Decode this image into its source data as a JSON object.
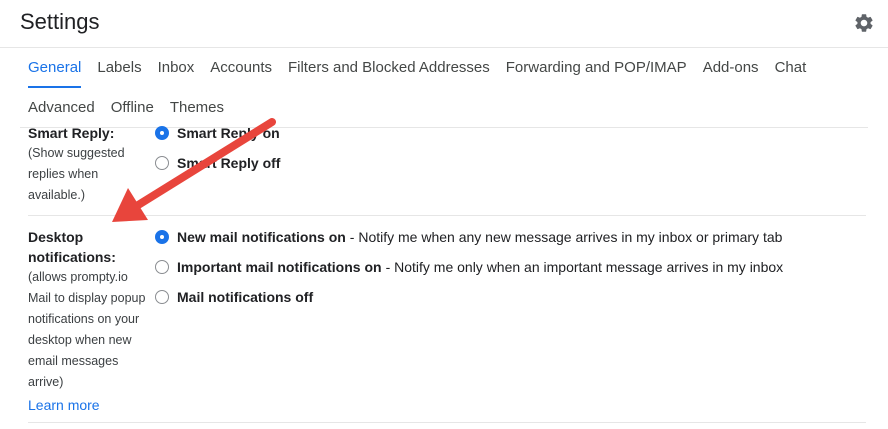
{
  "header": {
    "title": "Settings",
    "gear_icon": "gear-icon"
  },
  "tabs": [
    {
      "label": "General",
      "active": true
    },
    {
      "label": "Labels"
    },
    {
      "label": "Inbox"
    },
    {
      "label": "Accounts"
    },
    {
      "label": "Filters and Blocked Addresses"
    },
    {
      "label": "Forwarding and POP/IMAP"
    },
    {
      "label": "Add-ons"
    },
    {
      "label": "Chat"
    },
    {
      "label": "Advanced"
    },
    {
      "label": "Offline"
    },
    {
      "label": "Themes"
    }
  ],
  "smart_reply": {
    "title": "Smart Reply:",
    "desc": [
      "(Show suggested",
      "replies when",
      "available.)"
    ],
    "options": [
      {
        "label": "Smart Reply on",
        "checked": true
      },
      {
        "label": "Smart Reply off",
        "checked": false
      }
    ]
  },
  "desktop_notifications": {
    "title": [
      "Desktop",
      "notifications:"
    ],
    "desc": [
      "(allows prompty.io",
      "Mail to display popup",
      "notifications on your",
      "desktop when new",
      "email messages",
      "arrive)"
    ],
    "learn_more": "Learn more",
    "options": [
      {
        "label": "New mail notifications on",
        "desc": "- Notify me when any new message arrives in my inbox or primary tab",
        "checked": true
      },
      {
        "label": "Important mail notifications on",
        "desc": "- Notify me only when an important message arrives in my inbox",
        "checked": false
      },
      {
        "label": "Mail notifications off",
        "desc": "",
        "checked": false
      }
    ]
  },
  "colors": {
    "accent": "#1a73e8",
    "annotation_arrow": "#e8453c"
  }
}
